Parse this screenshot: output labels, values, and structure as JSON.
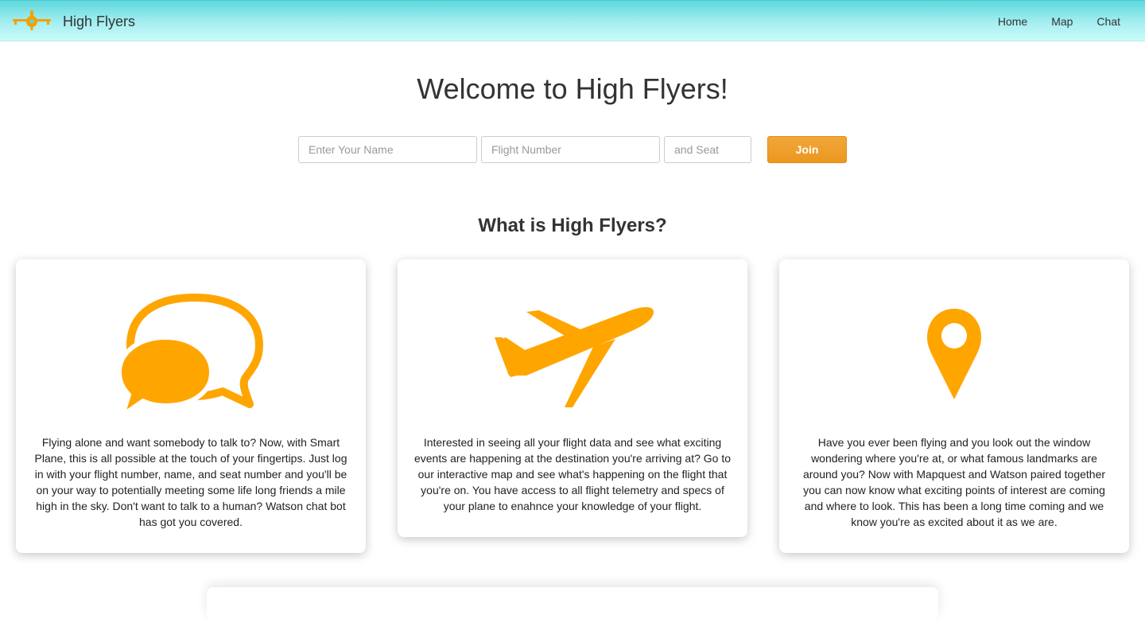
{
  "brand": {
    "name": "High Flyers",
    "icon": "plane-front-icon"
  },
  "nav": {
    "items": [
      {
        "label": "Home"
      },
      {
        "label": "Map"
      },
      {
        "label": "Chat"
      }
    ]
  },
  "hero": {
    "title": "Welcome to High Flyers!"
  },
  "join_form": {
    "name_placeholder": "Enter Your Name",
    "flight_placeholder": "Flight Number",
    "seat_placeholder": "and Seat",
    "join_label": "Join"
  },
  "about": {
    "heading": "What is High Flyers?",
    "cards": [
      {
        "icon": "chat-bubbles-icon",
        "text": "Flying alone and want somebody to talk to? Now, with Smart Plane, this is all possible at the touch of your fingertips. Just log in with your flight number, name, and seat number and you'll be on your way to potentially meeting some life long friends a mile high in the sky. Don't want to talk to a human? Watson chat bot has got you covered."
      },
      {
        "icon": "airplane-takeoff-icon",
        "text": "Interested in seeing all your flight data and see what exciting events are happening at the destination you're arriving at? Go to our interactive map and see what's happening on the flight that you're on. You have access to all flight telemetry and specs of your plane to enahnce your knowledge of your flight."
      },
      {
        "icon": "map-pin-icon",
        "text": "Have you ever been flying and you look out the window wondering where you're at, or what famous landmarks are around you? Now with Mapquest and Watson paired together you can now know what exciting points of interest are coming and where to look. This has been a long time coming and we know you're as excited about it as we are."
      }
    ]
  },
  "colors": {
    "accent": "#ffa500",
    "button": "#ec971f",
    "navbar_top": "#5fd9dd",
    "navbar_bottom": "#cafbfb"
  }
}
